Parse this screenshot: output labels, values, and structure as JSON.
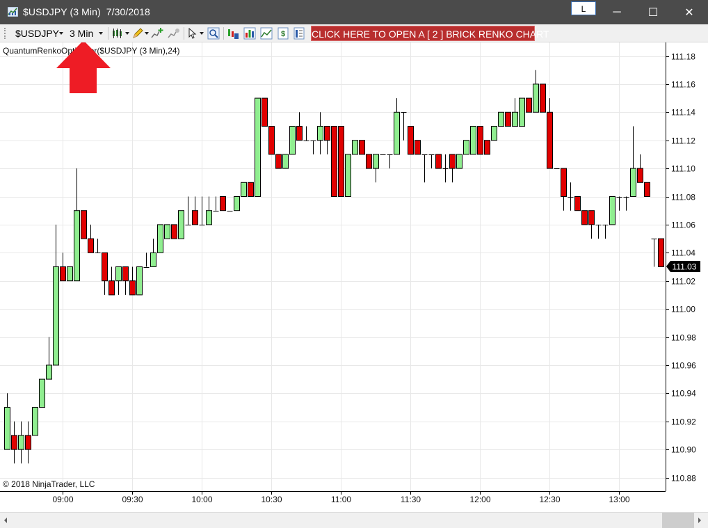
{
  "window": {
    "title": "$USDJPY (3 Min)  7/30/2018",
    "l_button": "L",
    "minimize_glyph": "─",
    "maximize_glyph": "☐",
    "close_glyph": "✕"
  },
  "toolbar": {
    "instrument": "$USDJPY",
    "interval": "3 Min",
    "renko_button": "CLICK HERE TO OPEN A [ 2 ] BRICK RENKO CHART",
    "icons": [
      "bar-style-icon",
      "draw-pencil-icon",
      "add-indicator-icon",
      "strategy-icon",
      "cursor-icon",
      "zoom-icon",
      "data-box-icon",
      "bar-chart-icon",
      "line-chart-icon",
      "order-entry-icon",
      "properties-icon"
    ]
  },
  "chart": {
    "indicator_label": "QuantumRenkoOptimizer($USDJPY (3 Min),24)",
    "copyright": "© 2018 NinjaTrader, LLC",
    "price_labels": [
      "111.18",
      "111.16",
      "111.14",
      "111.12",
      "111.10",
      "111.08",
      "111.06",
      "111.04",
      "111.02",
      "111.00",
      "110.98",
      "110.96",
      "110.94",
      "110.92",
      "110.90",
      "110.88"
    ],
    "time_labels": [
      "09:00",
      "09:30",
      "10:00",
      "10:30",
      "11:00",
      "11:30",
      "12:00",
      "12:30",
      "13:00"
    ],
    "last_price": "111.03",
    "colors": {
      "up": "#90ee90",
      "down": "#e00000",
      "grid": "#e8e8e8",
      "last_price_bg": "#000000",
      "annotation_arrow": "#ee1c25"
    }
  },
  "chart_data": {
    "type": "candlestick",
    "y_axis_range": [
      110.87,
      111.19
    ],
    "x_axis_range": [
      "08:35",
      "13:20"
    ],
    "candles": [
      {
        "t": "08:36",
        "o": 110.9,
        "h": 110.94,
        "l": 110.9,
        "c": 110.93
      },
      {
        "t": "08:39",
        "o": 110.91,
        "h": 110.92,
        "l": 110.89,
        "c": 110.9
      },
      {
        "t": "08:42",
        "o": 110.9,
        "h": 110.92,
        "l": 110.89,
        "c": 110.91
      },
      {
        "t": "08:45",
        "o": 110.91,
        "h": 110.92,
        "l": 110.89,
        "c": 110.9
      },
      {
        "t": "08:48",
        "o": 110.91,
        "h": 110.93,
        "l": 110.91,
        "c": 110.93
      },
      {
        "t": "08:51",
        "o": 110.93,
        "h": 110.95,
        "l": 110.93,
        "c": 110.95
      },
      {
        "t": "08:54",
        "o": 110.95,
        "h": 110.98,
        "l": 110.95,
        "c": 110.96
      },
      {
        "t": "08:57",
        "o": 110.96,
        "h": 111.06,
        "l": 110.96,
        "c": 111.03
      },
      {
        "t": "09:00",
        "o": 111.03,
        "h": 111.04,
        "l": 111.02,
        "c": 111.02
      },
      {
        "t": "09:03",
        "o": 111.02,
        "h": 111.03,
        "l": 111.02,
        "c": 111.03
      },
      {
        "t": "09:06",
        "o": 111.02,
        "h": 111.1,
        "l": 111.02,
        "c": 111.07
      },
      {
        "t": "09:09",
        "o": 111.07,
        "h": 111.07,
        "l": 111.05,
        "c": 111.05
      },
      {
        "t": "09:12",
        "o": 111.05,
        "h": 111.06,
        "l": 111.04,
        "c": 111.04
      },
      {
        "t": "09:15",
        "o": 111.04,
        "h": 111.05,
        "l": 111.04,
        "c": 111.04
      },
      {
        "t": "09:18",
        "o": 111.04,
        "h": 111.04,
        "l": 111.01,
        "c": 111.02
      },
      {
        "t": "09:21",
        "o": 111.02,
        "h": 111.03,
        "l": 111.01,
        "c": 111.01
      },
      {
        "t": "09:24",
        "o": 111.02,
        "h": 111.03,
        "l": 111.01,
        "c": 111.03
      },
      {
        "t": "09:27",
        "o": 111.03,
        "h": 111.03,
        "l": 111.01,
        "c": 111.02
      },
      {
        "t": "09:30",
        "o": 111.02,
        "h": 111.03,
        "l": 111.01,
        "c": 111.01
      },
      {
        "t": "09:33",
        "o": 111.01,
        "h": 111.03,
        "l": 111.01,
        "c": 111.03
      },
      {
        "t": "09:36",
        "o": 111.03,
        "h": 111.04,
        "l": 111.03,
        "c": 111.03
      },
      {
        "t": "09:39",
        "o": 111.03,
        "h": 111.05,
        "l": 111.03,
        "c": 111.04
      },
      {
        "t": "09:42",
        "o": 111.04,
        "h": 111.06,
        "l": 111.04,
        "c": 111.06
      },
      {
        "t": "09:45",
        "o": 111.05,
        "h": 111.06,
        "l": 111.05,
        "c": 111.06
      },
      {
        "t": "09:48",
        "o": 111.06,
        "h": 111.06,
        "l": 111.05,
        "c": 111.05
      },
      {
        "t": "09:51",
        "o": 111.05,
        "h": 111.07,
        "l": 111.05,
        "c": 111.07
      },
      {
        "t": "09:54",
        "o": 111.06,
        "h": 111.08,
        "l": 111.06,
        "c": 111.06
      },
      {
        "t": "09:57",
        "o": 111.07,
        "h": 111.08,
        "l": 111.06,
        "c": 111.06
      },
      {
        "t": "10:00",
        "o": 111.06,
        "h": 111.08,
        "l": 111.06,
        "c": 111.06
      },
      {
        "t": "10:03",
        "o": 111.06,
        "h": 111.08,
        "l": 111.06,
        "c": 111.07
      },
      {
        "t": "10:06",
        "o": 111.07,
        "h": 111.08,
        "l": 111.07,
        "c": 111.07
      },
      {
        "t": "10:09",
        "o": 111.08,
        "h": 111.08,
        "l": 111.07,
        "c": 111.07
      },
      {
        "t": "10:12",
        "o": 111.07,
        "h": 111.07,
        "l": 111.07,
        "c": 111.07
      },
      {
        "t": "10:15",
        "o": 111.07,
        "h": 111.08,
        "l": 111.07,
        "c": 111.08
      },
      {
        "t": "10:18",
        "o": 111.08,
        "h": 111.09,
        "l": 111.08,
        "c": 111.09
      },
      {
        "t": "10:21",
        "o": 111.09,
        "h": 111.09,
        "l": 111.08,
        "c": 111.08
      },
      {
        "t": "10:24",
        "o": 111.08,
        "h": 111.15,
        "l": 111.08,
        "c": 111.15
      },
      {
        "t": "10:27",
        "o": 111.15,
        "h": 111.15,
        "l": 111.13,
        "c": 111.13
      },
      {
        "t": "10:30",
        "o": 111.13,
        "h": 111.13,
        "l": 111.11,
        "c": 111.11
      },
      {
        "t": "10:33",
        "o": 111.11,
        "h": 111.11,
        "l": 111.1,
        "c": 111.1
      },
      {
        "t": "10:36",
        "o": 111.1,
        "h": 111.11,
        "l": 111.1,
        "c": 111.11
      },
      {
        "t": "10:39",
        "o": 111.11,
        "h": 111.13,
        "l": 111.11,
        "c": 111.13
      },
      {
        "t": "10:42",
        "o": 111.13,
        "h": 111.14,
        "l": 111.12,
        "c": 111.12
      },
      {
        "t": "10:45",
        "o": 111.12,
        "h": 111.13,
        "l": 111.12,
        "c": 111.12
      },
      {
        "t": "10:48",
        "o": 111.12,
        "h": 111.12,
        "l": 111.11,
        "c": 111.12
      },
      {
        "t": "10:51",
        "o": 111.12,
        "h": 111.14,
        "l": 111.11,
        "c": 111.13
      },
      {
        "t": "10:54",
        "o": 111.13,
        "h": 111.13,
        "l": 111.11,
        "c": 111.12
      },
      {
        "t": "10:57",
        "o": 111.13,
        "h": 111.13,
        "l": 111.08,
        "c": 111.08
      },
      {
        "t": "11:00",
        "o": 111.13,
        "h": 111.13,
        "l": 111.08,
        "c": 111.08
      },
      {
        "t": "11:03",
        "o": 111.08,
        "h": 111.11,
        "l": 111.08,
        "c": 111.11
      },
      {
        "t": "11:06",
        "o": 111.11,
        "h": 111.12,
        "l": 111.11,
        "c": 111.12
      },
      {
        "t": "11:09",
        "o": 111.12,
        "h": 111.12,
        "l": 111.11,
        "c": 111.11
      },
      {
        "t": "11:12",
        "o": 111.11,
        "h": 111.11,
        "l": 111.1,
        "c": 111.1
      },
      {
        "t": "11:15",
        "o": 111.1,
        "h": 111.11,
        "l": 111.09,
        "c": 111.11
      },
      {
        "t": "11:18",
        "o": 111.11,
        "h": 111.11,
        "l": 111.11,
        "c": 111.11
      },
      {
        "t": "11:21",
        "o": 111.11,
        "h": 111.11,
        "l": 111.1,
        "c": 111.11
      },
      {
        "t": "11:24",
        "o": 111.11,
        "h": 111.15,
        "l": 111.11,
        "c": 111.14
      },
      {
        "t": "11:27",
        "o": 111.14,
        "h": 111.14,
        "l": 111.12,
        "c": 111.14
      },
      {
        "t": "11:30",
        "o": 111.13,
        "h": 111.13,
        "l": 111.11,
        "c": 111.11
      },
      {
        "t": "11:33",
        "o": 111.12,
        "h": 111.12,
        "l": 111.11,
        "c": 111.11
      },
      {
        "t": "11:36",
        "o": 111.11,
        "h": 111.11,
        "l": 111.09,
        "c": 111.11
      },
      {
        "t": "11:39",
        "o": 111.11,
        "h": 111.11,
        "l": 111.1,
        "c": 111.11
      },
      {
        "t": "11:42",
        "o": 111.11,
        "h": 111.11,
        "l": 111.1,
        "c": 111.1
      },
      {
        "t": "11:45",
        "o": 111.1,
        "h": 111.11,
        "l": 111.09,
        "c": 111.1
      },
      {
        "t": "11:48",
        "o": 111.11,
        "h": 111.11,
        "l": 111.09,
        "c": 111.1
      },
      {
        "t": "11:51",
        "o": 111.1,
        "h": 111.11,
        "l": 111.1,
        "c": 111.11
      },
      {
        "t": "11:54",
        "o": 111.11,
        "h": 111.12,
        "l": 111.11,
        "c": 111.12
      },
      {
        "t": "11:57",
        "o": 111.11,
        "h": 111.13,
        "l": 111.11,
        "c": 111.13
      },
      {
        "t": "12:00",
        "o": 111.13,
        "h": 111.13,
        "l": 111.11,
        "c": 111.11
      },
      {
        "t": "12:03",
        "o": 111.12,
        "h": 111.12,
        "l": 111.11,
        "c": 111.11
      },
      {
        "t": "12:06",
        "o": 111.12,
        "h": 111.13,
        "l": 111.12,
        "c": 111.13
      },
      {
        "t": "12:09",
        "o": 111.13,
        "h": 111.14,
        "l": 111.13,
        "c": 111.14
      },
      {
        "t": "12:12",
        "o": 111.14,
        "h": 111.14,
        "l": 111.13,
        "c": 111.13
      },
      {
        "t": "12:15",
        "o": 111.13,
        "h": 111.15,
        "l": 111.13,
        "c": 111.14
      },
      {
        "t": "12:18",
        "o": 111.13,
        "h": 111.15,
        "l": 111.13,
        "c": 111.15
      },
      {
        "t": "12:21",
        "o": 111.15,
        "h": 111.15,
        "l": 111.14,
        "c": 111.14
      },
      {
        "t": "12:24",
        "o": 111.14,
        "h": 111.17,
        "l": 111.14,
        "c": 111.16
      },
      {
        "t": "12:27",
        "o": 111.16,
        "h": 111.16,
        "l": 111.14,
        "c": 111.14
      },
      {
        "t": "12:30",
        "o": 111.14,
        "h": 111.15,
        "l": 111.1,
        "c": 111.1
      },
      {
        "t": "12:33",
        "o": 111.1,
        "h": 111.1,
        "l": 111.1,
        "c": 111.1
      },
      {
        "t": "12:36",
        "o": 111.1,
        "h": 111.1,
        "l": 111.07,
        "c": 111.08
      },
      {
        "t": "12:39",
        "o": 111.08,
        "h": 111.09,
        "l": 111.07,
        "c": 111.08
      },
      {
        "t": "12:42",
        "o": 111.08,
        "h": 111.08,
        "l": 111.07,
        "c": 111.07
      },
      {
        "t": "12:45",
        "o": 111.07,
        "h": 111.07,
        "l": 111.06,
        "c": 111.06
      },
      {
        "t": "12:48",
        "o": 111.07,
        "h": 111.07,
        "l": 111.05,
        "c": 111.06
      },
      {
        "t": "12:51",
        "o": 111.06,
        "h": 111.06,
        "l": 111.05,
        "c": 111.06
      },
      {
        "t": "12:54",
        "o": 111.06,
        "h": 111.06,
        "l": 111.05,
        "c": 111.06
      },
      {
        "t": "12:57",
        "o": 111.06,
        "h": 111.08,
        "l": 111.06,
        "c": 111.08
      },
      {
        "t": "13:00",
        "o": 111.08,
        "h": 111.08,
        "l": 111.07,
        "c": 111.08
      },
      {
        "t": "13:03",
        "o": 111.08,
        "h": 111.08,
        "l": 111.07,
        "c": 111.08
      },
      {
        "t": "13:06",
        "o": 111.08,
        "h": 111.13,
        "l": 111.08,
        "c": 111.1
      },
      {
        "t": "13:09",
        "o": 111.1,
        "h": 111.11,
        "l": 111.09,
        "c": 111.09
      },
      {
        "t": "13:12",
        "o": 111.09,
        "h": 111.09,
        "l": 111.08,
        "c": 111.08
      },
      {
        "t": "13:15",
        "o": 111.05,
        "h": 111.05,
        "l": 111.03,
        "c": 111.05
      },
      {
        "t": "13:18",
        "o": 111.05,
        "h": 111.05,
        "l": 111.03,
        "c": 111.03
      }
    ]
  }
}
